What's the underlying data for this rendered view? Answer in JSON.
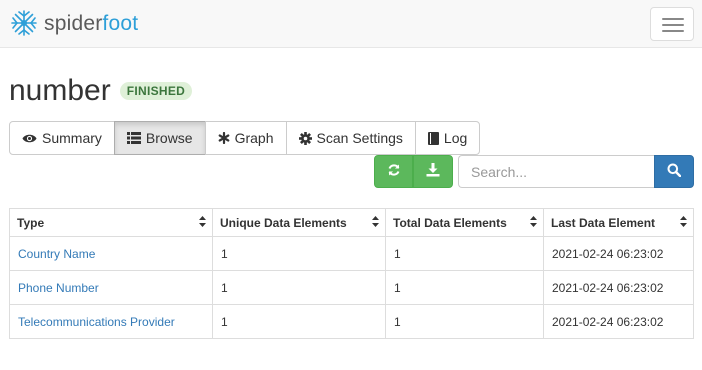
{
  "navbar": {
    "brand_spider": "spider",
    "brand_foot": "foot",
    "logo_icon": "spiderfoot-logo-icon",
    "menu_icon": "hamburger-menu-icon"
  },
  "scan": {
    "title": "number",
    "status": "FINISHED"
  },
  "tabs": [
    {
      "label": "Summary",
      "icon": "eye-icon",
      "active": false
    },
    {
      "label": "Browse",
      "icon": "list-icon",
      "active": true
    },
    {
      "label": "Graph",
      "icon": "asterisk-icon",
      "active": false
    },
    {
      "label": "Scan Settings",
      "icon": "gear-icon",
      "active": false
    },
    {
      "label": "Log",
      "icon": "book-icon",
      "active": false
    }
  ],
  "actions": {
    "refresh_icon": "refresh-icon",
    "download_icon": "download-icon"
  },
  "search": {
    "placeholder": "Search...",
    "value": "",
    "button_icon": "search-icon"
  },
  "table": {
    "headers": [
      "Type",
      "Unique Data Elements",
      "Total Data Elements",
      "Last Data Element"
    ],
    "rows": [
      [
        "Country Name",
        "1",
        "1",
        "2021-02-24 06:23:02"
      ],
      [
        "Phone Number",
        "1",
        "1",
        "2021-02-24 06:23:02"
      ],
      [
        "Telecommunications Provider",
        "1",
        "1",
        "2021-02-24 06:23:02"
      ]
    ]
  },
  "colors": {
    "brand_blue": "#2d9fd8",
    "success_green": "#5cb85c",
    "primary_blue": "#337ab7",
    "badge_bg": "#dff0d8",
    "badge_text": "#3c763d"
  }
}
